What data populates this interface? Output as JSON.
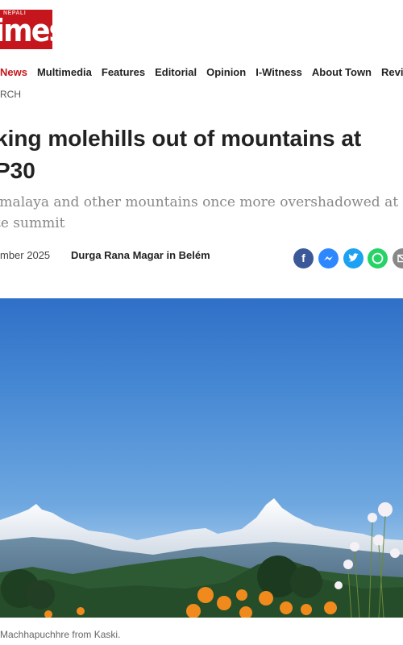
{
  "brand": {
    "logo_small": "NEPALI",
    "logo_big": "imes"
  },
  "nav": {
    "items": [
      "News",
      "Multimedia",
      "Features",
      "Editorial",
      "Opinion",
      "I-Witness",
      "About Town",
      "Revi"
    ]
  },
  "breadcrumb": "RCH",
  "article": {
    "headline_line1": "king molehills out of mountains at",
    "headline_line2": "P30",
    "subhead_line1": "imalaya and other mountains once more overshadowed at B",
    "subhead_line2": "te summit",
    "date": "mber 2025",
    "author": "Durga Rana Magar in Belém"
  },
  "share": {
    "icons": [
      "facebook-icon",
      "messenger-icon",
      "twitter-icon",
      "whatsapp-icon",
      "email-icon"
    ],
    "colors": {
      "facebook": "#3b5998",
      "messenger": "#2d88ff",
      "twitter": "#1da1f2",
      "whatsapp": "#25d366",
      "email": "#888888"
    }
  },
  "image": {
    "caption": "Machhapuchhre from Kaski."
  }
}
